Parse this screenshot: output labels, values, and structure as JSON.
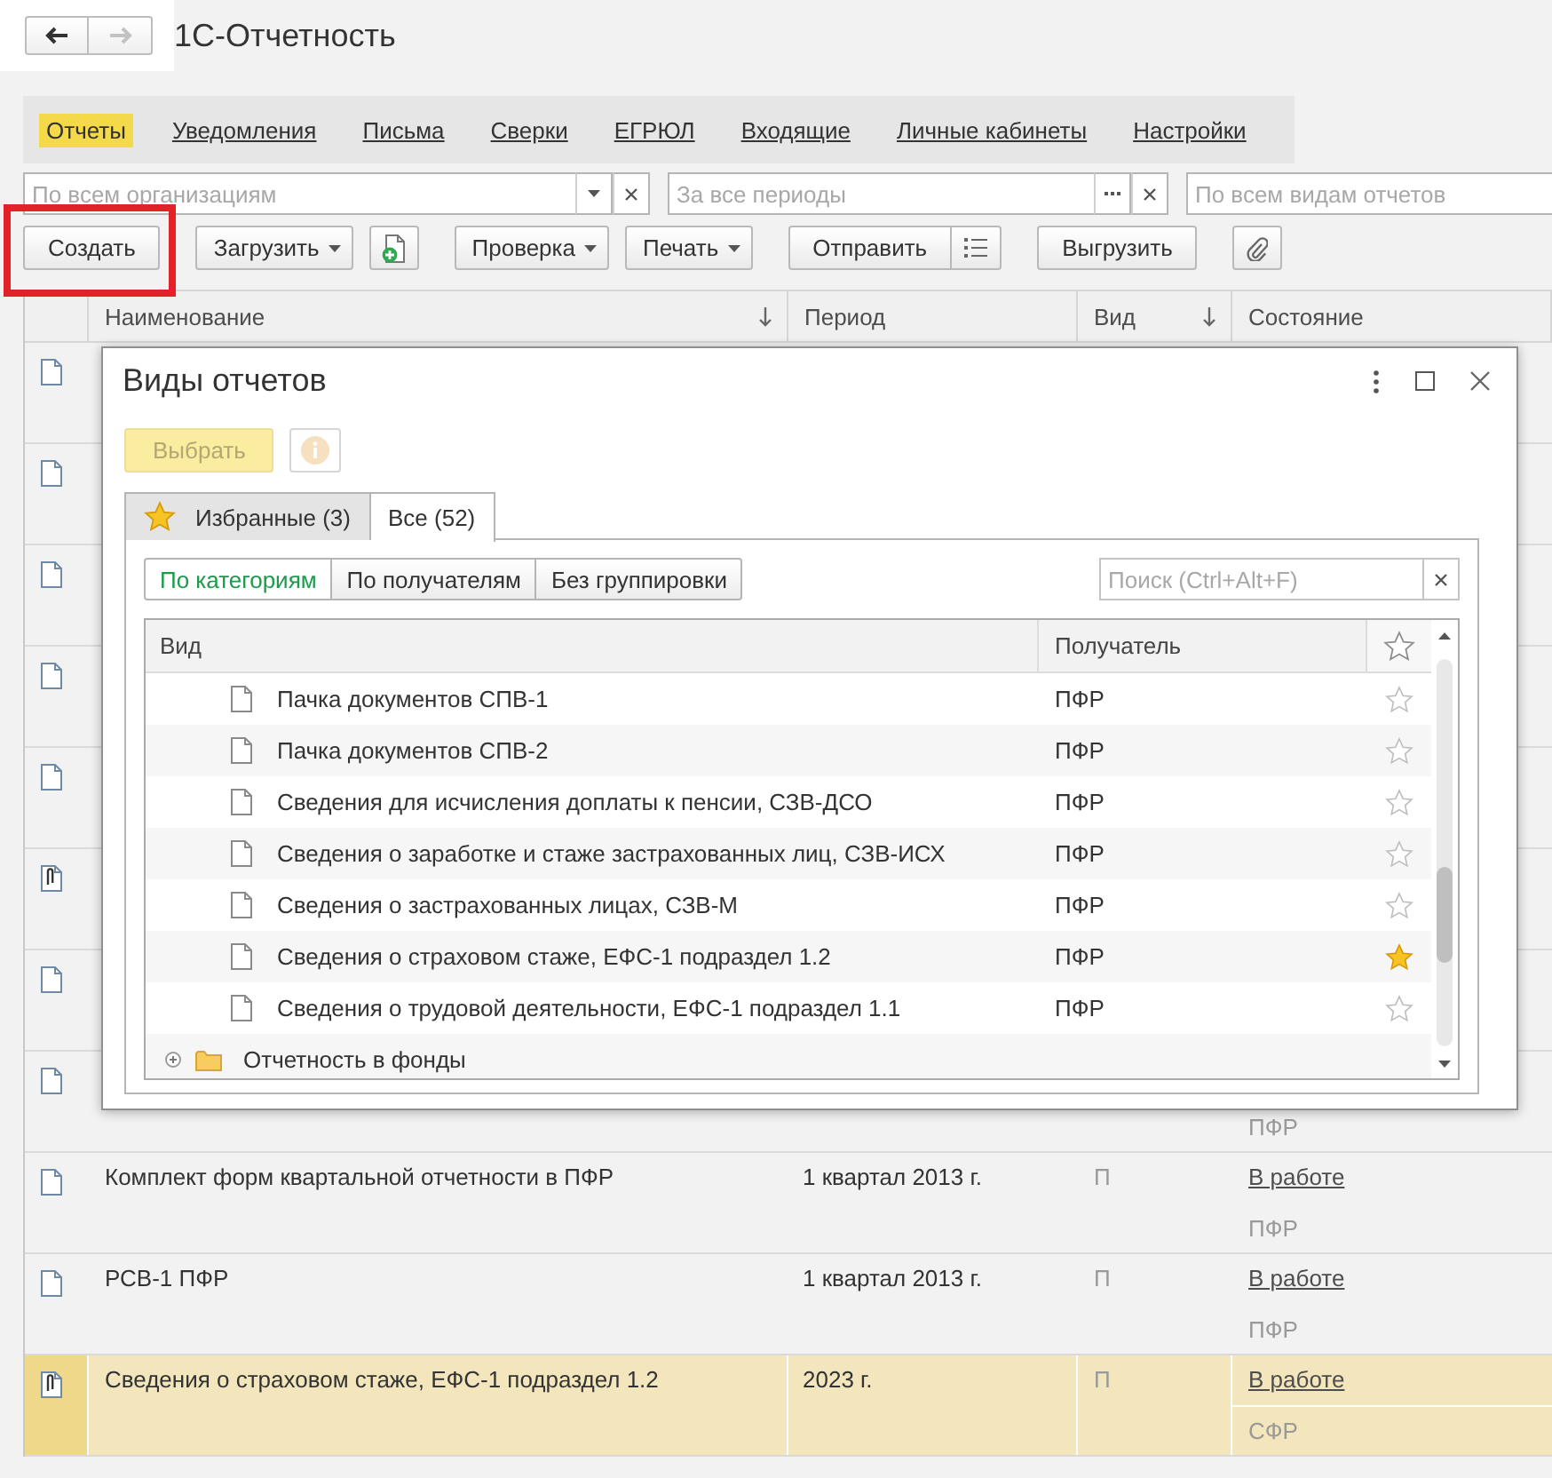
{
  "window": {
    "title": "1С-Отчетность"
  },
  "history": [
    {
      "kind": "back",
      "disabled": false
    },
    {
      "kind": "forward",
      "disabled": true
    }
  ],
  "sections": [
    {
      "label": "Отчеты",
      "selected": true
    },
    {
      "label": "Уведомления",
      "selected": false
    },
    {
      "label": "Письма",
      "selected": false
    },
    {
      "label": "Сверки",
      "selected": false
    },
    {
      "label": "ЕГРЮЛ",
      "selected": false
    },
    {
      "label": "Входящие",
      "selected": false
    },
    {
      "label": "Личные кабинеты",
      "selected": false
    },
    {
      "label": "Настройки",
      "selected": false
    }
  ],
  "filters": [
    {
      "kind": "dropdown",
      "placeholder": "По всем организациям"
    },
    {
      "kind": "choice",
      "placeholder": "За все периоды"
    },
    {
      "kind": "plain",
      "placeholder": "По всем видам отчетов"
    }
  ],
  "toolbar": [
    {
      "buttons": [
        {
          "kind": "button",
          "label": "Создать",
          "highlighted": true
        }
      ]
    },
    {
      "buttons": [
        {
          "kind": "menu",
          "label": "Загрузить",
          "highlighted": false
        },
        {
          "kind": "new-file",
          "highlighted": false
        }
      ]
    },
    {
      "buttons": [
        {
          "kind": "menu",
          "label": "Проверка",
          "highlighted": false
        },
        {
          "kind": "menu",
          "label": "Печать",
          "highlighted": false
        }
      ]
    },
    {
      "buttons": [
        {
          "kind": "split",
          "label": "Отправить",
          "highlighted": false
        }
      ]
    },
    {
      "buttons": [
        {
          "kind": "button",
          "label": "Выгрузить",
          "highlighted": false
        }
      ]
    },
    {
      "buttons": [
        {
          "kind": "attach",
          "highlighted": false
        }
      ]
    }
  ],
  "table": {
    "columns": [
      {
        "label": "Наименование",
        "sorted": true
      },
      {
        "label": "Период",
        "sorted": false
      },
      {
        "label": "Вид",
        "sorted": true
      },
      {
        "label": "Состояние",
        "sorted": false
      }
    ],
    "rows": [
      {
        "kind": "document",
        "selected": false
      },
      {
        "kind": "document",
        "selected": false
      },
      {
        "kind": "document",
        "selected": false
      },
      {
        "kind": "document",
        "selected": false
      },
      {
        "kind": "document",
        "selected": false
      },
      {
        "kind": "document-attached",
        "selected": false
      },
      {
        "kind": "document",
        "selected": false
      },
      {
        "kind": "document",
        "recipient": "ПФР",
        "selected": false
      },
      {
        "kind": "document",
        "name": "Комплект форм квартальной отчетности в ПФР",
        "period": "1 квартал 2013 г.",
        "type": "П",
        "status": "В работе",
        "recipient": "ПФР",
        "selected": false
      },
      {
        "kind": "document",
        "name": "РСВ-1 ПФР",
        "period": "1 квартал 2013 г.",
        "type": "П",
        "status": "В работе",
        "recipient": "ПФР",
        "selected": false
      },
      {
        "kind": "document-attached",
        "name": "Сведения о страховом стаже, ЕФС-1 подраздел 1.2",
        "period": "2023 г.",
        "type": "П",
        "status": "В работе",
        "recipient": "СФР",
        "selected": true
      }
    ]
  },
  "dialog": {
    "title": "Виды отчетов",
    "select_button": {
      "label": "Выбрать",
      "disabled": true
    },
    "info_button": {
      "disabled": true
    },
    "tabs": [
      {
        "kind": "favorites",
        "label": "Избранные (3)",
        "selected": false
      },
      {
        "kind": "all",
        "label": "Все (52)",
        "selected": true
      }
    ],
    "groupings": [
      {
        "label": "По категориям",
        "selected": true
      },
      {
        "label": "По получателям",
        "selected": false
      },
      {
        "label": "Без группировки",
        "selected": false
      }
    ],
    "search": {
      "placeholder": "Поиск (Ctrl+Alt+F)"
    },
    "list": {
      "columns": [
        {
          "label": "Вид"
        },
        {
          "label": "Получатель"
        }
      ],
      "items": [
        {
          "kind": "report",
          "name": "Пачка документов СПВ-1",
          "recipient": "ПФР",
          "favorite": false
        },
        {
          "kind": "report",
          "name": "Пачка документов СПВ-2",
          "recipient": "ПФР",
          "favorite": false
        },
        {
          "kind": "report",
          "name": "Сведения для исчисления доплаты к пенсии, СЗВ-ДСО",
          "recipient": "ПФР",
          "favorite": false
        },
        {
          "kind": "report",
          "name": "Сведения о заработке и стаже застрахованных лиц, СЗВ-ИСХ",
          "recipient": "ПФР",
          "favorite": false
        },
        {
          "kind": "report",
          "name": "Сведения о застрахованных лицах, СЗВ-М",
          "recipient": "ПФР",
          "favorite": false
        },
        {
          "kind": "report",
          "name": "Сведения о страховом стаже, ЕФС-1 подраздел 1.2",
          "recipient": "ПФР",
          "favorite": true
        },
        {
          "kind": "report",
          "name": "Сведения о трудовой деятельности, ЕФС-1 подраздел 1.1",
          "recipient": "ПФР",
          "favorite": false
        },
        {
          "kind": "group",
          "name": "Отчетность в фонды",
          "expanded": false
        }
      ]
    }
  }
}
